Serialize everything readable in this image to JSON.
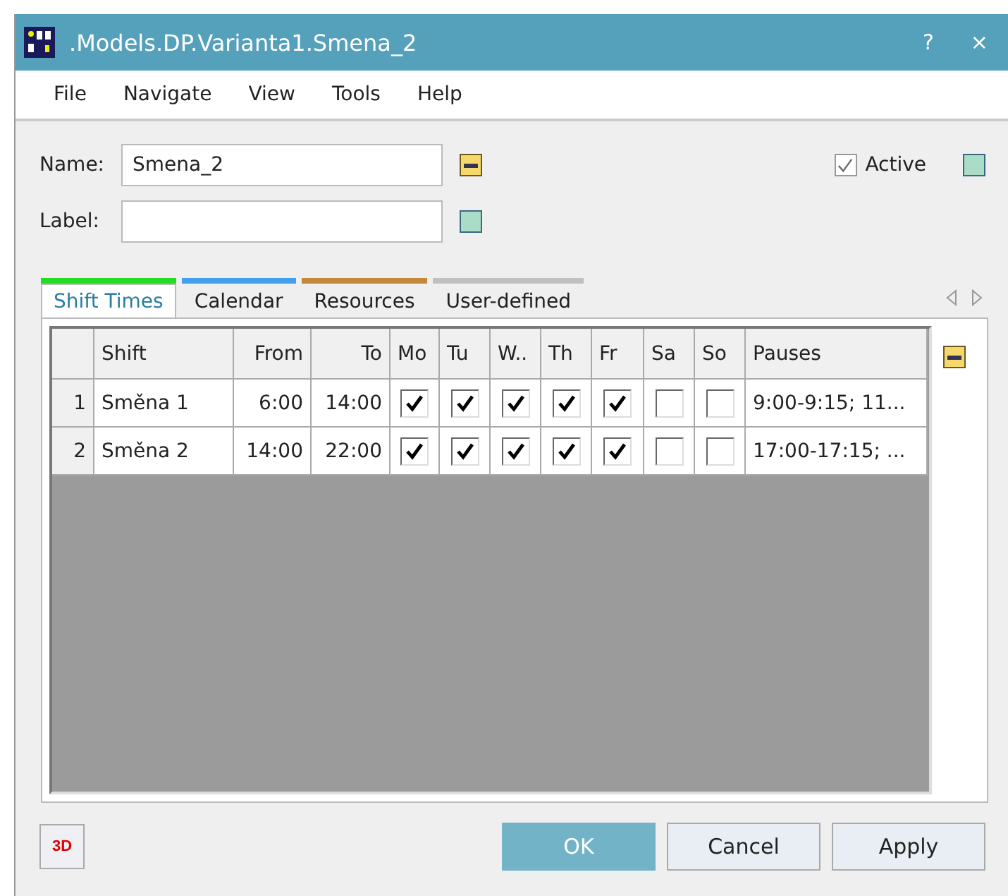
{
  "window": {
    "title": ".Models.DP.Varianta1.Smena_2",
    "help": "?",
    "close": "×"
  },
  "menu": [
    "File",
    "Navigate",
    "View",
    "Tools",
    "Help"
  ],
  "name_field": {
    "label": "Name:",
    "value": "Smena_2"
  },
  "label_field": {
    "label": "Label:"
  },
  "active": {
    "label": "Active",
    "checked": true
  },
  "tabs": [
    {
      "label": "Shift Times",
      "selected": true,
      "color": "#22dd22"
    },
    {
      "label": "Calendar",
      "selected": false,
      "color": "#44a0ee"
    },
    {
      "label": "Resources",
      "selected": false,
      "color": "#c08a3a"
    },
    {
      "label": "User-defined",
      "selected": false,
      "color": "#c0c0c0"
    }
  ],
  "table": {
    "columns": [
      "Shift",
      "From",
      "To",
      "Mo",
      "Tu",
      "W..",
      "Th",
      "Fr",
      "Sa",
      "So",
      "Pauses"
    ],
    "rows": [
      {
        "number": "1",
        "shift": "Směna 1",
        "from": "6:00",
        "to": "14:00",
        "days": [
          true,
          true,
          true,
          true,
          true,
          false,
          false
        ],
        "pauses": "9:00-9:15; 11..."
      },
      {
        "number": "2",
        "shift": "Směna 2",
        "from": "14:00",
        "to": "22:00",
        "days": [
          true,
          true,
          true,
          true,
          true,
          false,
          false
        ],
        "pauses": "17:00-17:15; ..."
      }
    ]
  },
  "three_d_button": "3D",
  "buttons": [
    {
      "label": "OK",
      "kind": "primary"
    },
    {
      "label": "Cancel",
      "kind": "normal"
    },
    {
      "label": "Apply",
      "kind": "normal"
    }
  ]
}
